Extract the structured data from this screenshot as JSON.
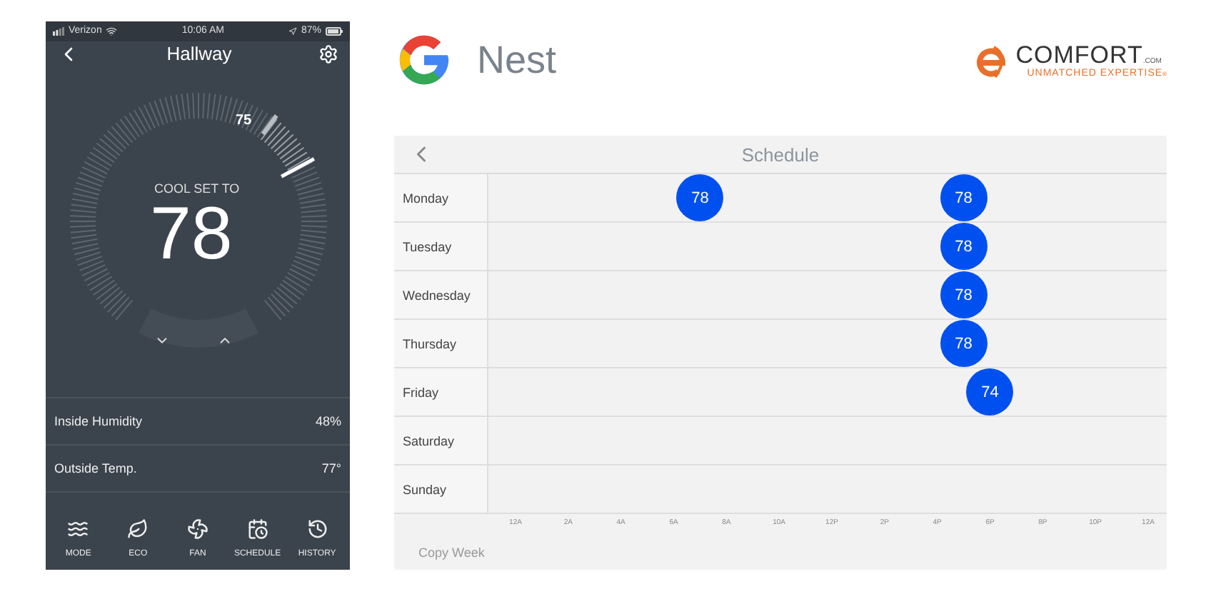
{
  "phone": {
    "status_bar": {
      "carrier": "Verizon",
      "time": "10:06 AM",
      "battery": "87%"
    },
    "title": "Hallway",
    "thermostat": {
      "current": "75",
      "mode_label": "COOL SET TO",
      "setpoint": "78"
    },
    "readings": [
      {
        "label": "Inside Humidity",
        "value": "48%"
      },
      {
        "label": "Outside Temp.",
        "value": "77°"
      }
    ],
    "nav": [
      {
        "kind": "mode",
        "label": "MODE"
      },
      {
        "kind": "eco",
        "label": "ECO"
      },
      {
        "kind": "fan",
        "label": "FAN"
      },
      {
        "kind": "schedule",
        "label": "SCHEDULE"
      },
      {
        "kind": "history",
        "label": "HISTORY"
      }
    ]
  },
  "header": {
    "brand": "Nest",
    "partner": {
      "name": "COMFORT",
      "domain": ".COM",
      "tagline": "UNMATCHED EXPERTISE",
      "mark": "®"
    }
  },
  "schedule": {
    "title": "Schedule",
    "days": [
      {
        "name": "Monday",
        "events": [
          {
            "temp": "78"
          },
          {
            "temp": "78"
          }
        ]
      },
      {
        "name": "Tuesday",
        "events": [
          {
            "temp": "78"
          }
        ]
      },
      {
        "name": "Wednesday",
        "events": [
          {
            "temp": "78"
          }
        ]
      },
      {
        "name": "Thursday",
        "events": [
          {
            "temp": "78"
          }
        ]
      },
      {
        "name": "Friday",
        "events": [
          {
            "temp": "74"
          }
        ]
      },
      {
        "name": "Saturday"
      },
      {
        "name": "Sunday"
      }
    ],
    "hour_labels": [
      "12A",
      "2A",
      "4A",
      "6A",
      "8A",
      "10A",
      "12P",
      "2P",
      "4P",
      "6P",
      "8P",
      "10P",
      "12A"
    ],
    "copy_week": "Copy Week"
  }
}
